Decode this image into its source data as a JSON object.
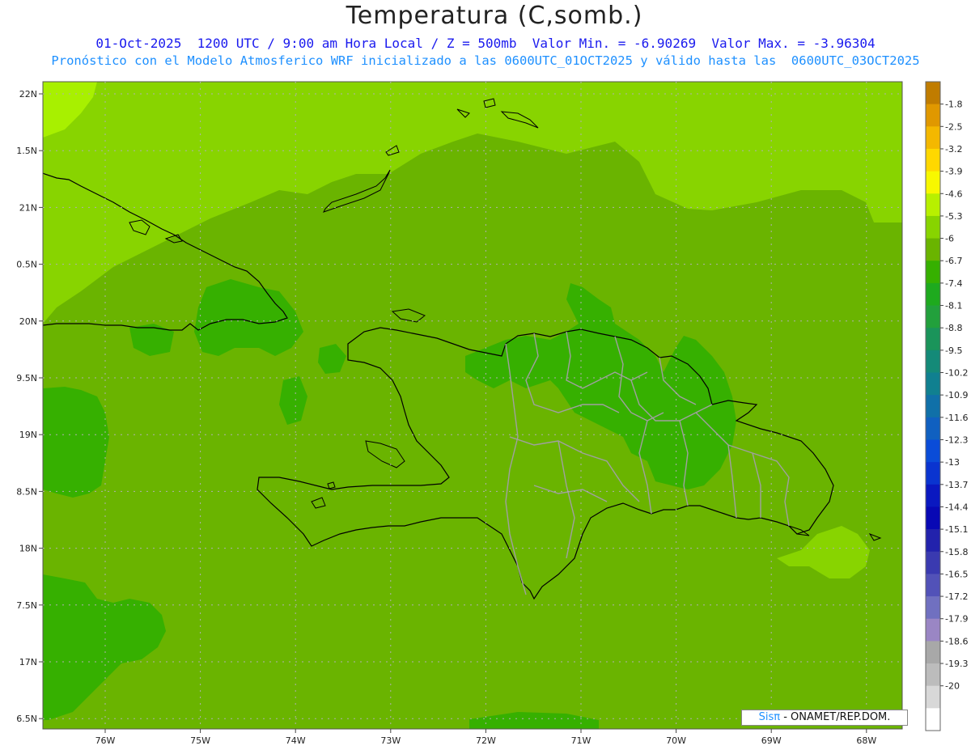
{
  "header": {
    "title": "Temperatura (C,somb.)",
    "line1": "01-Oct-2025  1200 UTC / 9:00 am Hora Local / Z = 500mb  Valor Min. = -6.90269  Valor Max. = -3.96304",
    "line2": "Pronóstico con el Modelo Atmosferico WRF inicializado a las 0600UTC_01OCT2025 y válido hasta las  0600UTC_03OCT2025"
  },
  "axes": {
    "lat_labels": [
      "22N",
      "1.5N",
      "21N",
      "0.5N",
      "20N",
      "9.5N",
      "19N",
      "8.5N",
      "18N",
      "7.5N",
      "17N",
      "6.5N"
    ],
    "lon_labels": [
      "76W",
      "75W",
      "74W",
      "73W",
      "72W",
      "71W",
      "70W",
      "69W",
      "68W"
    ]
  },
  "colorbar": {
    "labels": [
      "-1.8",
      "-2.5",
      "-3.2",
      "-3.9",
      "-4.6",
      "-5.3",
      "-6",
      "-6.7",
      "-7.4",
      "-8.1",
      "-8.8",
      "-9.5",
      "-10.2",
      "-10.9",
      "-11.6",
      "-12.3",
      "-13",
      "-13.7",
      "-14.4",
      "-15.1",
      "-15.8",
      "-16.5",
      "-17.2",
      "-17.9",
      "-18.6",
      "-19.3",
      "-20"
    ],
    "colors": [
      "#c07c00",
      "#e09800",
      "#f4b800",
      "#ffd800",
      "#f8f800",
      "#b8f000",
      "#88d400",
      "#6ab400",
      "#36b000",
      "#1eaa1e",
      "#22a03c",
      "#1a945a",
      "#148a78",
      "#108090",
      "#1070a8",
      "#1060c0",
      "#0a4cd8",
      "#0a34d0",
      "#0a18c0",
      "#0808b4",
      "#2222ac",
      "#3a3ab0",
      "#5252b8",
      "#7070c0",
      "#9a86c4",
      "#a8a8a8",
      "#bcbcbc",
      "#d8d8d8",
      "#ffffff"
    ]
  },
  "map_colors": {
    "band_46": "#a8f000",
    "band_53": "#88d400",
    "band_60": "#6ab400",
    "band_67": "#36b000",
    "coast": "#000000",
    "provinces": "#a0a0a0"
  },
  "credit": {
    "brand": "Sisπ",
    "text": " - ONAMET/REP.DOM."
  }
}
